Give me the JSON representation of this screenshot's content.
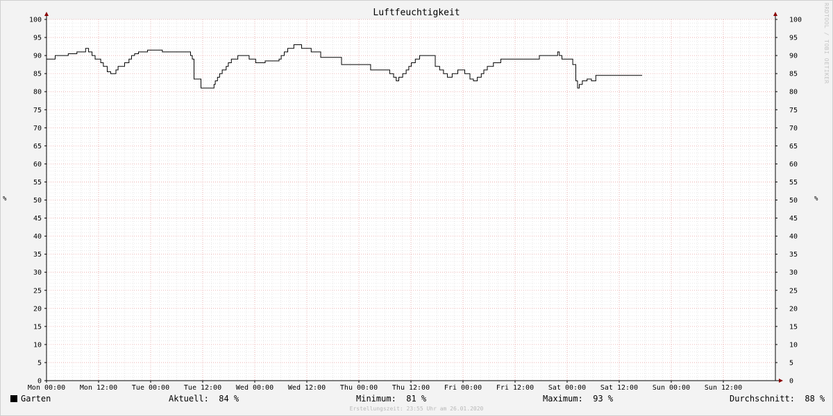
{
  "watermark": "RRDTOOL / TOBI OETIKER",
  "legend": {
    "swatch_color": "#000000",
    "name": "Garten",
    "current_label": "Aktuell:",
    "current_value": "84 %",
    "min_label": "Minimum:",
    "min_value": "81 %",
    "max_label": "Maximum:",
    "max_value": "93 %",
    "avg_label": "Durchschnitt:",
    "avg_value": "88 %"
  },
  "footer": {
    "created": "Erstellungszeit: 23:55 Uhr am 26.01.2020"
  },
  "chart_data": {
    "type": "line",
    "title": "Luftfeuchtigkeit",
    "ylabel": "%",
    "ylabel_right": "%",
    "ylim": [
      0,
      100
    ],
    "yticks": [
      0,
      5,
      10,
      15,
      20,
      25,
      30,
      35,
      40,
      45,
      50,
      55,
      60,
      65,
      70,
      75,
      80,
      85,
      90,
      95,
      100
    ],
    "xlim_hours": [
      0,
      168
    ],
    "xtick_hours": [
      0,
      12,
      24,
      36,
      48,
      60,
      72,
      84,
      96,
      108,
      120,
      132,
      144,
      156
    ],
    "xtick_labels": [
      "Mon 00:00",
      "Mon 12:00",
      "Tue 00:00",
      "Tue 12:00",
      "Wed 00:00",
      "Wed 12:00",
      "Thu 00:00",
      "Thu 12:00",
      "Fri 00:00",
      "Fri 12:00",
      "Sat 00:00",
      "Sat 12:00",
      "Sun 00:00",
      "Sun 12:00"
    ],
    "grid": true,
    "series": [
      {
        "name": "Garten",
        "color": "#000000",
        "step": true,
        "x_hours": [
          0,
          2,
          5,
          7,
          9,
          9.7,
          10.5,
          11.2,
          12.5,
          13.1,
          14,
          14.8,
          16,
          16.5,
          18,
          19,
          19.6,
          20.3,
          21.2,
          22,
          23.3,
          26.7,
          33.2,
          33.6,
          34,
          35.6,
          38.6,
          38.9,
          39.4,
          39.9,
          40.5,
          41.4,
          41.9,
          42.6,
          43.3,
          44.1,
          46.7,
          48.2,
          50.4,
          53.6,
          54.1,
          54.8,
          55.6,
          57,
          58.8,
          61,
          63.2,
          68,
          74.7,
          79.1,
          80,
          80.6,
          81.2,
          82.1,
          82.9,
          83.5,
          84.1,
          85,
          86,
          89.6,
          90.6,
          91.5,
          92.4,
          93.5,
          94.8,
          96.4,
          96.9,
          97.6,
          98.4,
          99.3,
          100.2,
          100.8,
          101.6,
          103,
          104.7,
          113.6,
          117.8,
          118.2,
          118.8,
          121.3,
          122,
          122.4,
          122.8,
          123.5,
          124.6,
          125.6,
          126.6,
          130.5,
          137.3,
          138.1,
          139.1,
          139.3,
          140.2,
          140.4,
          141,
          141.8,
          143.5,
          144
        ],
        "values": [
          89,
          90,
          90.5,
          91,
          92,
          91,
          90,
          89,
          88,
          87,
          85.5,
          85,
          86,
          87,
          88,
          89,
          90,
          90.5,
          91,
          91,
          91.5,
          91,
          90,
          89,
          83.5,
          81,
          82,
          83,
          84,
          85,
          86,
          87,
          88,
          89,
          89,
          90,
          89,
          88,
          88.5,
          89,
          90,
          91,
          92,
          93,
          92,
          91,
          89.5,
          87.5,
          86,
          85,
          84,
          83,
          84,
          85,
          86,
          87,
          88,
          89,
          90,
          87,
          86,
          85,
          84,
          85,
          86,
          85,
          85,
          83.5,
          83,
          84,
          85,
          86,
          87,
          88,
          89,
          90,
          91,
          90,
          89,
          87.5,
          83,
          81,
          82,
          83,
          83.5,
          83,
          84.5,
          84.5
        ]
      }
    ]
  }
}
